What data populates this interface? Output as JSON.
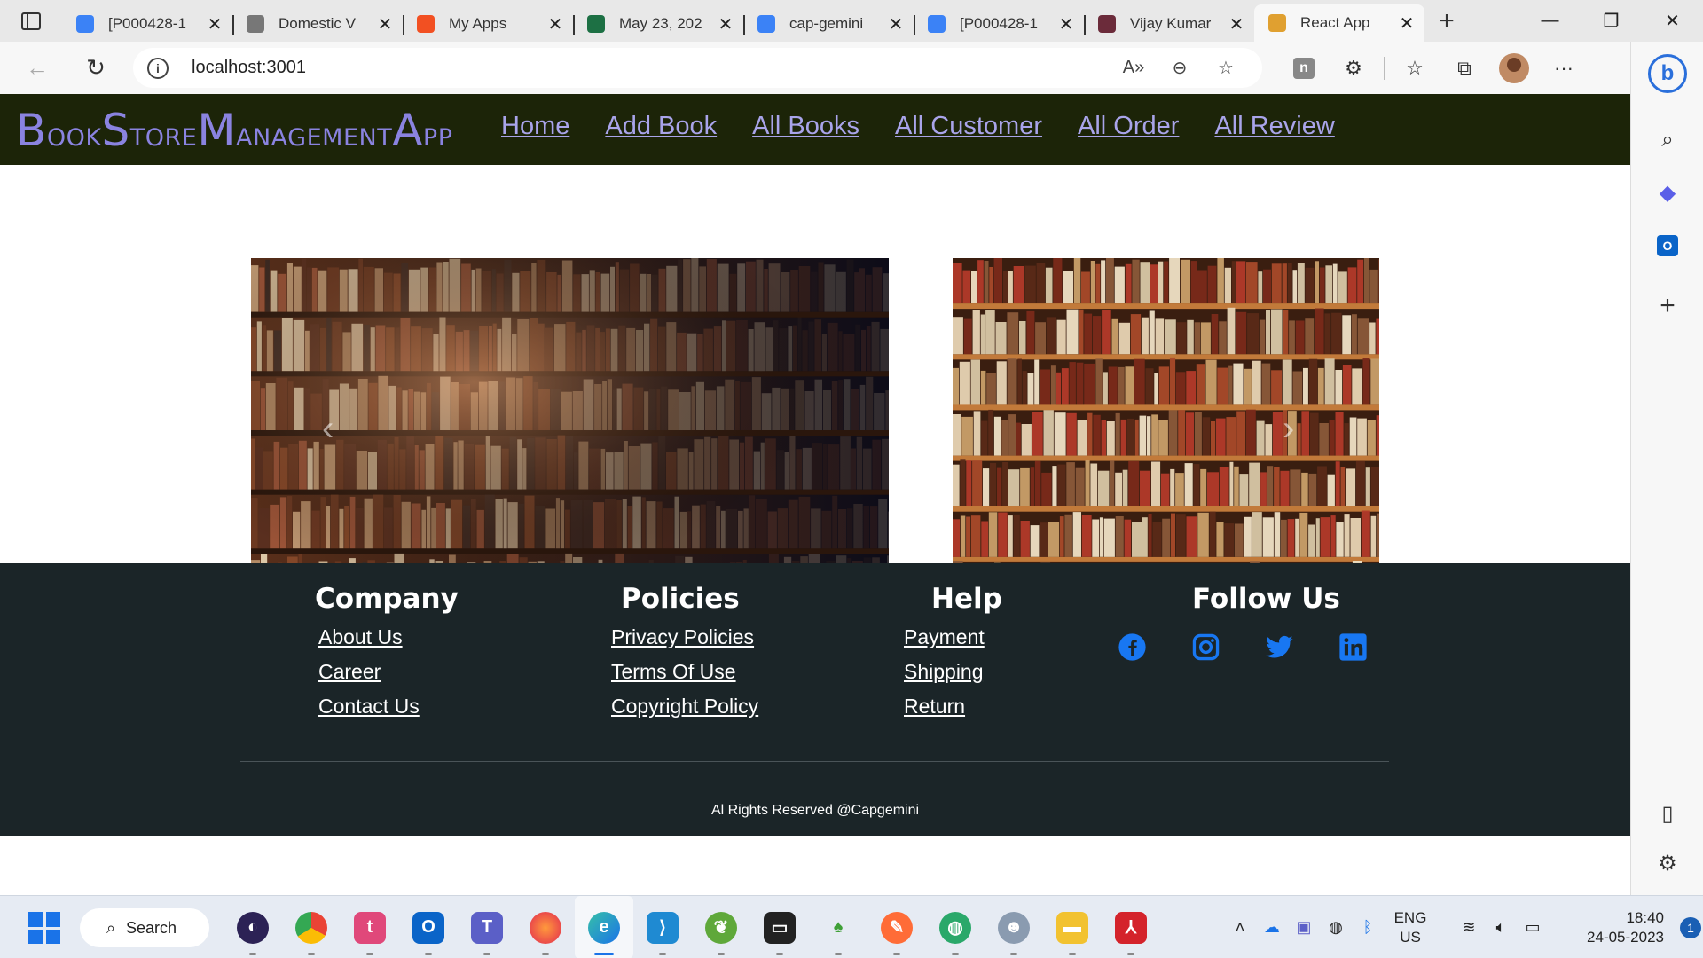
{
  "browser": {
    "tabs": [
      {
        "title": "[P000428-1",
        "favicon_color": "#3b82f6",
        "active": false
      },
      {
        "title": "Domestic V",
        "favicon_color": "#777777",
        "active": false
      },
      {
        "title": "My Apps",
        "favicon_color": "#f25022",
        "active": false
      },
      {
        "title": "May 23, 202",
        "favicon_color": "#1d7044",
        "active": false
      },
      {
        "title": "cap-gemini",
        "favicon_color": "#3b82f6",
        "active": false
      },
      {
        "title": "[P000428-1",
        "favicon_color": "#3b82f6",
        "active": false
      },
      {
        "title": "Vijay Kumar",
        "favicon_color": "#6b2b3a",
        "active": false
      },
      {
        "title": "React App",
        "favicon_color": "#e0a030",
        "active": true
      }
    ],
    "close_glyph": "✕",
    "new_tab_glyph": "+",
    "window": {
      "minimize": "—",
      "restore": "❐",
      "close": "✕"
    },
    "url": "localhost:3001"
  },
  "site": {
    "brand_parts": [
      {
        "big": "B",
        "small": "OOK"
      },
      {
        "big": "S",
        "small": "TORE"
      },
      {
        "big": "M",
        "small": "ANAGEMENT"
      },
      {
        "big": "A",
        "small": "PP"
      }
    ],
    "nav": [
      "Home",
      "Add Book",
      "All Books",
      "All Customer",
      "All Order",
      "All Review"
    ],
    "carousel": {
      "indicator_count": 5,
      "active_indicator": 1,
      "prev_glyph": "‹",
      "next_glyph": "›"
    }
  },
  "footer": {
    "company": {
      "heading": "Company",
      "links": [
        "About Us",
        "Career",
        "Contact Us"
      ]
    },
    "policies": {
      "heading": "Policies",
      "links": [
        "Privacy Policies",
        "Terms Of Use",
        "Copyright Policy"
      ]
    },
    "help": {
      "heading": "Help",
      "links": [
        "Payment",
        "Shipping",
        "Return"
      ]
    },
    "follow": {
      "heading": "Follow Us",
      "icons": [
        "facebook-icon",
        "instagram-icon",
        "twitter-icon",
        "linkedin-icon"
      ]
    },
    "copyright": "Al Rights Reserved @Capgemini",
    "social_color": "#1877f2"
  },
  "taskbar": {
    "search_label": "Search",
    "lang_line1": "ENG",
    "lang_line2": "US",
    "time": "18:40",
    "date": "24-05-2023",
    "notification_count": "1"
  }
}
